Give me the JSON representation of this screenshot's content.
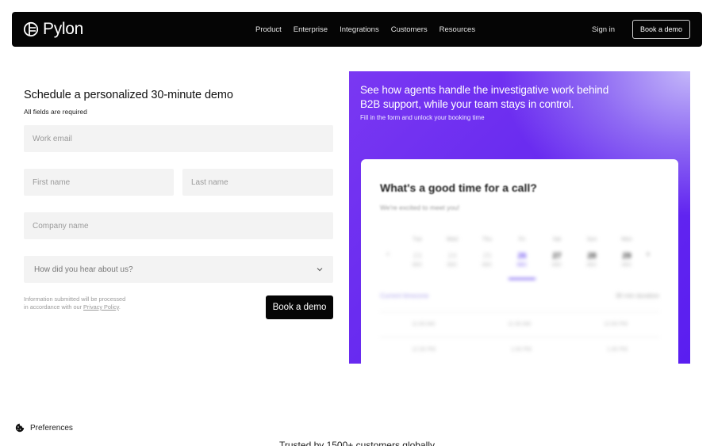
{
  "nav": {
    "brand": "Pylon",
    "links": [
      "Product",
      "Enterprise",
      "Integrations",
      "Customers",
      "Resources"
    ],
    "sign_in": "Sign in",
    "cta": "Book a demo"
  },
  "form": {
    "title": "Schedule a personalized 30-minute demo",
    "subtitle": "All fields are required",
    "fields": {
      "work_email": "Work email",
      "first_name": "First name",
      "last_name": "Last name",
      "company_name": "Company name",
      "referral": "How did you hear about us?"
    },
    "privacy_text": "Information submitted will be processed in accordance with our",
    "privacy_link": "Privacy Policy",
    "submit": "Book a demo"
  },
  "promo": {
    "headline": "See how agents handle the investigative work behind B2B support, while your team stays in control.",
    "subtext": "Fill in the form and unlock your booking time",
    "card": {
      "title": "What's a good time for a call?",
      "subtitle": "We're excited to meet you!",
      "days": [
        {
          "name": "Tue",
          "num": "23",
          "mon": "DEC"
        },
        {
          "name": "Wed",
          "num": "24",
          "mon": "DEC"
        },
        {
          "name": "Thu",
          "num": "25",
          "mon": "DEC"
        },
        {
          "name": "Fri",
          "num": "26",
          "mon": "DEC"
        },
        {
          "name": "Sat",
          "num": "27",
          "mon": "DEC"
        },
        {
          "name": "Sun",
          "num": "28",
          "mon": "DEC"
        },
        {
          "name": "Mon",
          "num": "29",
          "mon": "DEC"
        }
      ],
      "timezone": "Current timezone",
      "duration": "30 min duration",
      "slots": [
        [
          "11:00 AM",
          "11:30 AM",
          "12:00 PM"
        ],
        [
          "12:30 PM",
          "1:00 PM",
          "1:30 PM"
        ]
      ]
    }
  },
  "footer": {
    "preferences": "Preferences",
    "trusted": "Trusted by 1500+ customers globally"
  },
  "colors": {
    "nav_bg": "#050505",
    "accent": "#6a2cf0",
    "field_bg": "#f3f3f3"
  }
}
